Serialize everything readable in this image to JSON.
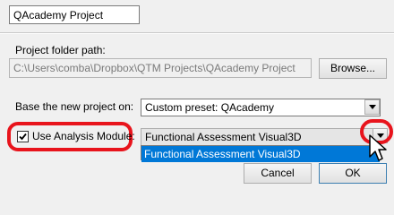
{
  "project_name": {
    "value": "QAcademy Project"
  },
  "folder": {
    "label": "Project folder path:",
    "value": "C:\\Users\\comba\\Dropbox\\QTM Projects\\QAcademy Project",
    "browse_label": "Browse..."
  },
  "base": {
    "label": "Base the new project on:",
    "selected": "Custom preset: QAcademy"
  },
  "analysis": {
    "label": "Use Analysis Module:",
    "checked": true,
    "selected": "Functional Assessment Visual3D",
    "options": [
      "Functional Assessment Visual3D"
    ]
  },
  "buttons": {
    "cancel": "Cancel",
    "ok": "OK"
  },
  "colors": {
    "highlight": "#0078d7",
    "annotation": "#e8141c"
  }
}
